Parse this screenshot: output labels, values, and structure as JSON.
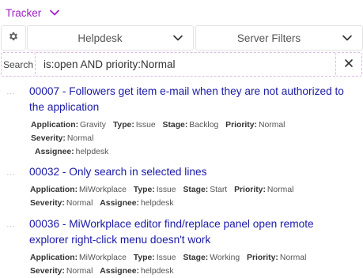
{
  "header": {
    "app_title": "Tracker",
    "app_chevron_icon": "chevron-down-icon",
    "accent": "#a020c8"
  },
  "filters": {
    "settings_icon": "gear-icon",
    "project_label": "Helpdesk",
    "filter_label": "Server Filters"
  },
  "search": {
    "label": "Search",
    "value": "is:open AND priority:Normal",
    "clear_icon": "close-icon"
  },
  "issues": [
    {
      "title": "00007 - Followers get item e-mail when they are not authorized to the application",
      "fields": {
        "application_key": "Application:",
        "application": "Gravity",
        "type_key": "Type:",
        "type": "Issue",
        "stage_key": "Stage:",
        "stage": "Backlog",
        "priority_key": "Priority:",
        "priority": "Normal",
        "severity_key": "Severity:",
        "severity": "Normal",
        "assignee_key": "Assignee:",
        "assignee": "helpdesk"
      }
    },
    {
      "title": "00032 - Only search in selected lines",
      "fields": {
        "application_key": "Application:",
        "application": "MiWorkplace",
        "type_key": "Type:",
        "type": "Issue",
        "stage_key": "Stage:",
        "stage": "Start",
        "priority_key": "Priority:",
        "priority": "Normal",
        "severity_key": "Severity:",
        "severity": "Normal",
        "assignee_key": "Assignee:",
        "assignee": "helpdesk"
      }
    },
    {
      "title": "00036 - MiWorkplace editor find/replace panel open remote explorer right-click menu doesn't work",
      "fields": {
        "application_key": "Application:",
        "application": "MiWorkplace",
        "type_key": "Type:",
        "type": "Issue",
        "stage_key": "Stage:",
        "stage": "Working",
        "priority_key": "Priority:",
        "priority": "Normal",
        "severity_key": "Severity:",
        "severity": "Normal",
        "assignee_key": "Assignee:",
        "assignee": "helpdesk"
      }
    }
  ]
}
